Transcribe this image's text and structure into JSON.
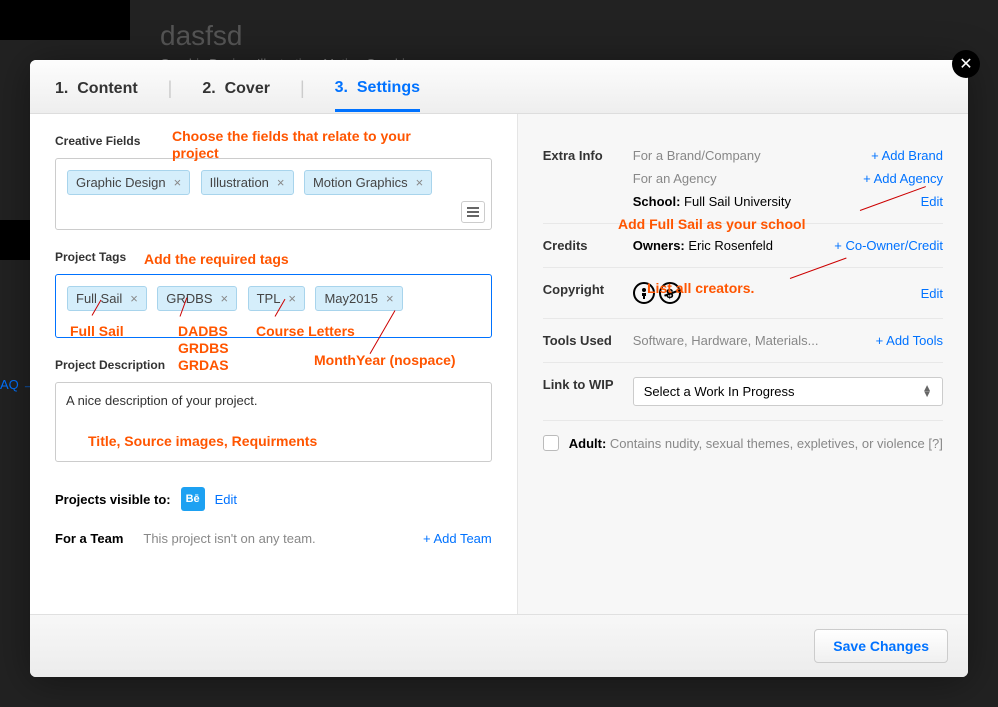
{
  "background": {
    "title": "dasfsd",
    "subtitle": "Graphic Design, Illustration, Motion Graphics",
    "faq": "AQ →"
  },
  "steps": [
    {
      "num": "1.",
      "label": "Content"
    },
    {
      "num": "2.",
      "label": "Cover"
    },
    {
      "num": "3.",
      "label": "Settings"
    }
  ],
  "left": {
    "creative_fields_label": "Creative Fields",
    "creative_fields": [
      "Graphic Design",
      "Illustration",
      "Motion Graphics"
    ],
    "project_tags_label": "Project Tags",
    "project_tags": [
      "Full Sail",
      "GRDBS",
      "TPL",
      "May2015"
    ],
    "description_label": "Project Description",
    "description_value": "A nice description of your project.",
    "visible_label": "Projects visible to:",
    "edit": "Edit",
    "team_label": "For a Team",
    "team_text": "This project isn't on any team.",
    "add_team": "+ Add Team"
  },
  "right": {
    "extra_info_label": "Extra Info",
    "brand_text": "For a Brand/Company",
    "add_brand": "+ Add Brand",
    "agency_text": "For an Agency",
    "add_agency": "+ Add Agency",
    "school_label": "School:",
    "school_value": "Full Sail University",
    "edit": "Edit",
    "credits_label": "Credits",
    "owners_label": "Owners:",
    "owners_value": "Eric Rosenfeld",
    "add_credit": "+ Co-Owner/Credit",
    "copyright_label": "Copyright",
    "tools_label": "Tools Used",
    "tools_text": "Software, Hardware, Materials...",
    "add_tools": "+ Add Tools",
    "wip_label": "Link to WIP",
    "wip_select": "Select a Work In Progress",
    "adult_label": "Adult:",
    "adult_text": "Contains nudity, sexual themes, expletives, or violence [?]"
  },
  "footer": {
    "save": "Save Changes"
  },
  "annotations": {
    "fields_hint": "Choose the fields that relate to your project",
    "tags_hint": "Add the required tags",
    "course_letters": "Course Letters",
    "month_year": "MonthYear (nospace)",
    "full_sail": "Full Sail",
    "dadbs": "DADBS\nGRDBS\nGRDAS",
    "desc_hint": "Title, Source images, Requirments",
    "school_hint": "Add Full Sail as your school",
    "creators_hint": "List all creators."
  }
}
